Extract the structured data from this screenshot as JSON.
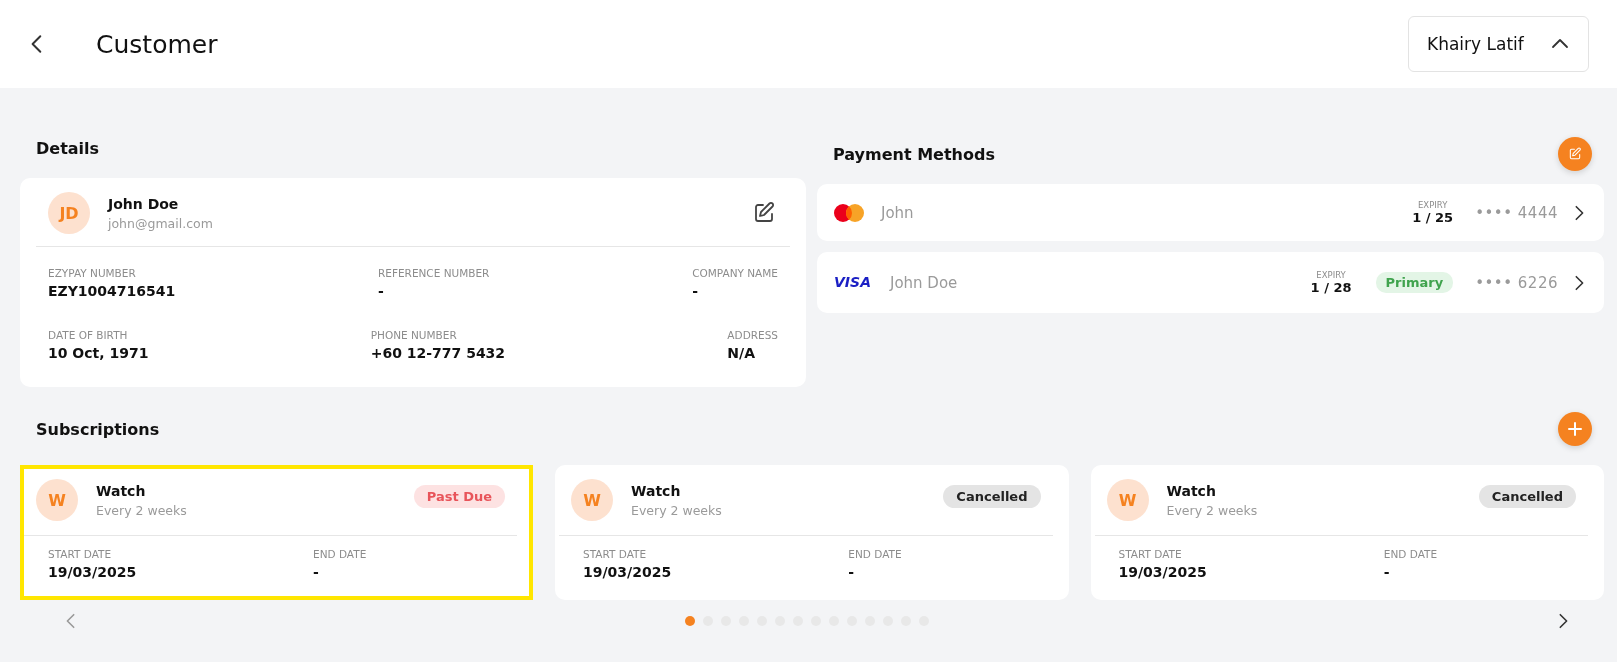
{
  "header": {
    "title": "Customer",
    "user": "Khairy Latif",
    "user_menu_expanded": true
  },
  "details": {
    "heading": "Details",
    "initials": "JD",
    "name": "John Doe",
    "email": "john@gmail.com",
    "rows": [
      [
        {
          "label": "EZYPAY NUMBER",
          "value": "EZY1004716541"
        },
        {
          "label": "REFERENCE NUMBER",
          "value": "-"
        },
        {
          "label": "COMPANY NAME",
          "value": "-"
        }
      ],
      [
        {
          "label": "DATE OF BIRTH",
          "value": "10 Oct, 1971"
        },
        {
          "label": "PHONE NUMBER",
          "value": "+60 12-777 5432"
        },
        {
          "label": "ADDRESS",
          "value": "N/A"
        }
      ]
    ]
  },
  "payment_methods": {
    "heading": "Payment Methods",
    "cards": [
      {
        "kind": "mastercard",
        "name": "John",
        "expiry_label": "EXPIRY",
        "expiry": "1 / 25",
        "primary": false,
        "dots": "••••",
        "last4": "4444"
      },
      {
        "kind": "visa",
        "brand": "VISA",
        "name": "John Doe",
        "expiry_label": "EXPIRY",
        "expiry": "1 / 28",
        "primary": true,
        "badge": "Primary",
        "dots": "••••",
        "last4": "6226"
      }
    ]
  },
  "subscriptions": {
    "heading": "Subscriptions",
    "items": [
      {
        "initial": "W",
        "name": "Watch",
        "frequency": "Every 2 weeks",
        "status": "Past Due",
        "kind": "past_due",
        "selected": true,
        "start_label": "START DATE",
        "start": "19/03/2025",
        "end_label": "END DATE",
        "end": "-"
      },
      {
        "initial": "W",
        "name": "Watch",
        "frequency": "Every 2 weeks",
        "status": "Cancelled",
        "kind": "cancelled",
        "selected": false,
        "start_label": "START DATE",
        "start": "19/03/2025",
        "end_label": "END DATE",
        "end": "-"
      },
      {
        "initial": "W",
        "name": "Watch",
        "frequency": "Every 2 weeks",
        "status": "Cancelled",
        "kind": "cancelled",
        "selected": false,
        "start_label": "START DATE",
        "start": "19/03/2025",
        "end_label": "END DATE",
        "end": "-"
      }
    ],
    "pages": [
      {
        "selected": true
      },
      {
        "selected": false
      },
      {
        "selected": false
      },
      {
        "selected": false
      },
      {
        "selected": false
      },
      {
        "selected": false
      },
      {
        "selected": false
      },
      {
        "selected": false
      },
      {
        "selected": false
      },
      {
        "selected": false
      },
      {
        "selected": false
      },
      {
        "selected": false
      },
      {
        "selected": false
      },
      {
        "selected": false
      }
    ]
  }
}
